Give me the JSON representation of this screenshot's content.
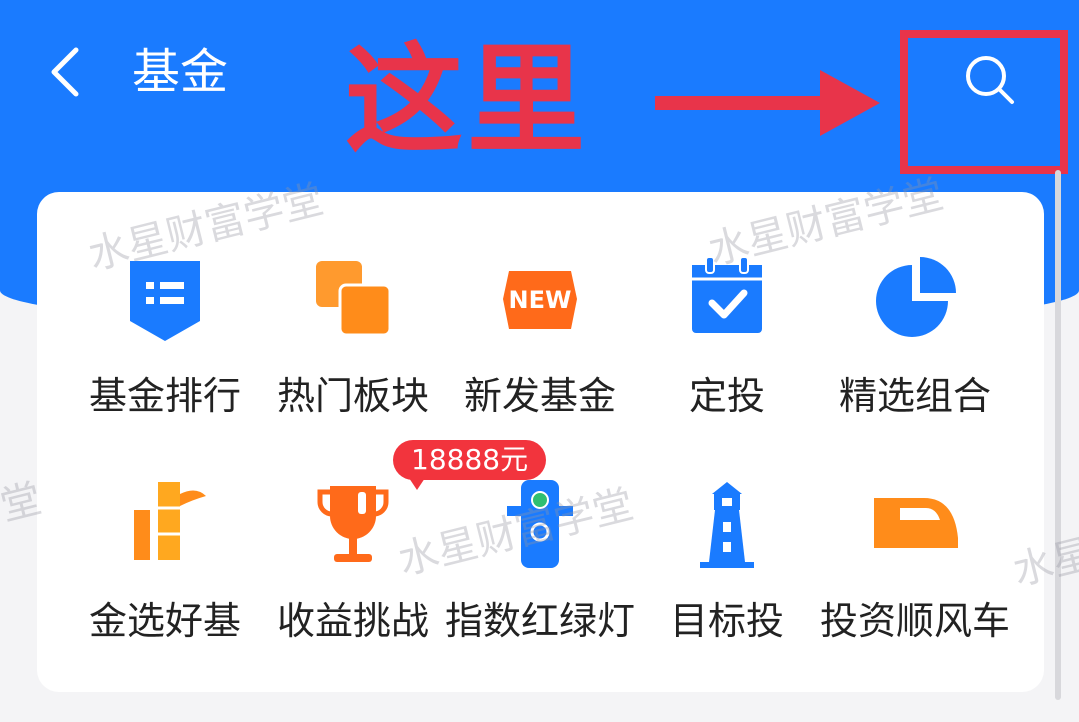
{
  "header": {
    "title": "基金"
  },
  "annotation": {
    "text": "这里"
  },
  "grid": {
    "items": [
      {
        "label": "基金排行"
      },
      {
        "label": "热门板块"
      },
      {
        "label": "新发基金",
        "icon_text": "NEW"
      },
      {
        "label": "定投"
      },
      {
        "label": "精选组合"
      },
      {
        "label": "金选好基"
      },
      {
        "label": "收益挑战",
        "badge": "18888元"
      },
      {
        "label": "指数红绿灯"
      },
      {
        "label": "目标投"
      },
      {
        "label": "投资顺风车"
      }
    ]
  },
  "watermark": {
    "text": "水星财富学堂",
    "partial": "堂",
    "partial2": "水星"
  },
  "colors": {
    "primary": "#1a7bff",
    "accent": "#e8344a",
    "orange": "#ff8c1a",
    "badge": "#f2343d"
  }
}
